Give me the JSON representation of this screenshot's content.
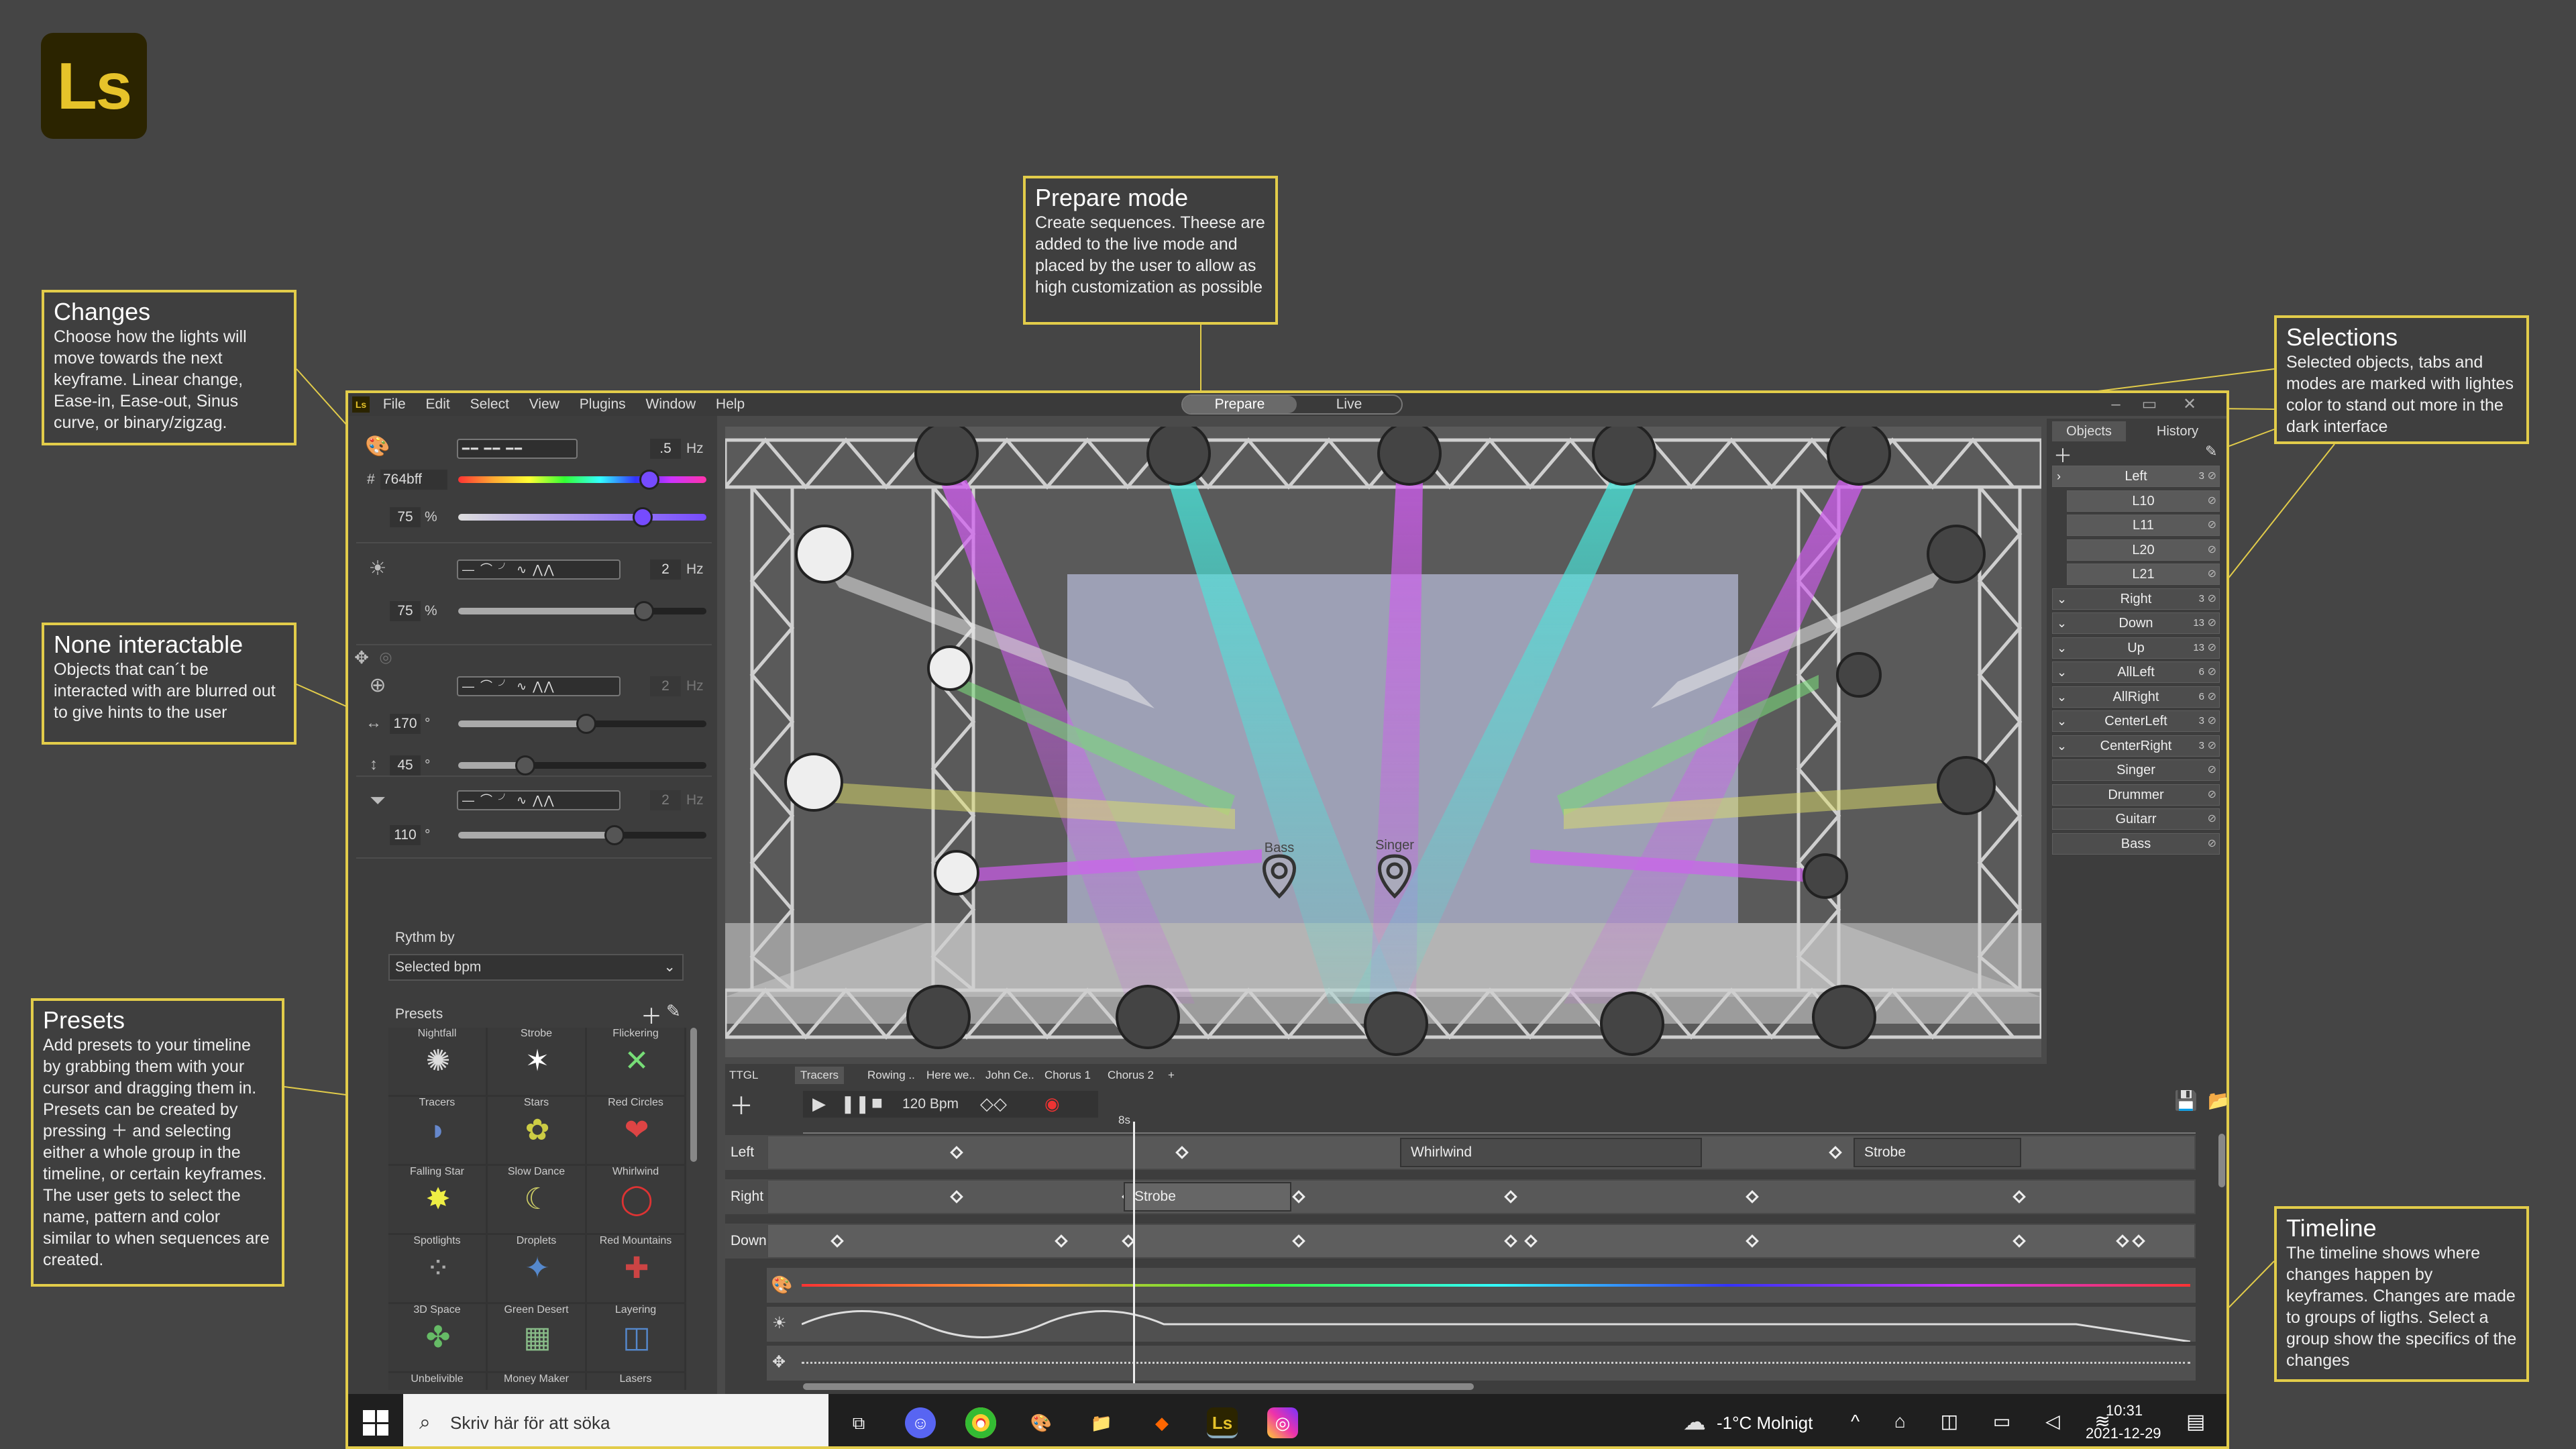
{
  "logo": "Ls",
  "notes": {
    "prepare": {
      "title": "Prepare mode",
      "body": "Create sequences. Theese are added to the live mode and placed by the user to allow as high customization as possible"
    },
    "changes": {
      "title": "Changes",
      "body": "Choose how the lights will move towards the next keyframe. Linear change, Ease-in, Ease-out, Sinus curve, or binary/zigzag."
    },
    "none": {
      "title": "None interactable",
      "body": "Objects that can´t be interacted with are blurred out to give hints to the user"
    },
    "presets": {
      "title": "Presets",
      "body": "Add presets to your timeline by grabbing them with your cursor and dragging them in. Presets can be created by pressing ＋ and selecting either a whole group in the timeline, or certain keyframes. The user gets to select the name, pattern and color similar to when sequences are created."
    },
    "selections": {
      "title": "Selections",
      "body": "Selected objects, tabs and modes are marked with lightes color to stand out more in the dark interface"
    },
    "timeline": {
      "title": "Timeline",
      "body": "The timeline shows where changes happen by keyframes. Changes are made to groups of ligths. Select a group show the specifics of the changes"
    }
  },
  "app": {
    "menu": [
      "File",
      "Edit",
      "Select",
      "View",
      "Plugins",
      "Window",
      "Help"
    ],
    "modes": {
      "prepare": "Prepare",
      "live": "Live"
    },
    "window_buttons": [
      "–",
      "▭",
      "✕"
    ]
  },
  "left": {
    "color": {
      "hz": ".5",
      "hz_unit": "Hz",
      "hex": "764bff",
      "hash": "#",
      "saturation": "75",
      "pct": "%"
    },
    "brightness": {
      "hz": "2",
      "hz_unit": "Hz",
      "value": "75",
      "pct": "%"
    },
    "movement": {
      "hz": "2",
      "hz_unit": "Hz",
      "pan": "170",
      "tilt": "45",
      "deg": "°"
    },
    "zoom": {
      "hz": "2",
      "hz_unit": "Hz",
      "value": "110",
      "deg": "°"
    },
    "wave_shapes": "— ⌒ ╯ ∿ ⋀⋀",
    "rhythm_label": "Rythm by",
    "rhythm_value": "Selected bpm",
    "presets_label": "Presets",
    "presets": [
      "Nightfall",
      "Strobe",
      "Flickering",
      "Tracers",
      "Stars",
      "Red Circles",
      "Falling Star",
      "Slow Dance",
      "Whirlwind",
      "Spotlights",
      "Droplets",
      "Red Mountains",
      "3D Space",
      "Green Desert",
      "Layering",
      "Unbelivible",
      "Money Maker",
      "Lasers"
    ]
  },
  "stage": {
    "markers": [
      "Bass",
      "Singer"
    ]
  },
  "right": {
    "tabs": {
      "objects": "Objects",
      "history": "History"
    },
    "rows": [
      {
        "name": "Left",
        "count": "3",
        "indent": false,
        "caret": "›"
      },
      {
        "name": "L10",
        "count": "",
        "indent": true,
        "caret": ""
      },
      {
        "name": "L11",
        "count": "",
        "indent": true,
        "caret": ""
      },
      {
        "name": "L20",
        "count": "",
        "indent": true,
        "caret": ""
      },
      {
        "name": "L21",
        "count": "",
        "indent": true,
        "caret": ""
      },
      {
        "name": "Right",
        "count": "3",
        "indent": false,
        "caret": "⌄"
      },
      {
        "name": "Down",
        "count": "13",
        "indent": false,
        "caret": "⌄"
      },
      {
        "name": "Up",
        "count": "13",
        "indent": false,
        "caret": "⌄"
      },
      {
        "name": "AllLeft",
        "count": "6",
        "indent": false,
        "caret": "⌄"
      },
      {
        "name": "AllRight",
        "count": "6",
        "indent": false,
        "caret": "⌄"
      },
      {
        "name": "CenterLeft",
        "count": "3",
        "indent": false,
        "caret": "⌄"
      },
      {
        "name": "CenterRight",
        "count": "3",
        "indent": false,
        "caret": "⌄"
      },
      {
        "name": "Singer",
        "count": "",
        "indent": false,
        "caret": ""
      },
      {
        "name": "Drummer",
        "count": "",
        "indent": false,
        "caret": ""
      },
      {
        "name": "Guitarr",
        "count": "",
        "indent": false,
        "caret": ""
      },
      {
        "name": "Bass",
        "count": "",
        "indent": false,
        "caret": ""
      }
    ]
  },
  "timeline": {
    "tabs": [
      "TTGL",
      "Tracers",
      "Rowing ..",
      "Here we..",
      "John Ce..",
      "Chorus 1",
      "Chorus 2",
      "+"
    ],
    "bpm": "120 Bpm",
    "playhead": "8s",
    "lanes": [
      "Left",
      "Right",
      "Down"
    ],
    "clips": [
      "Whirlwind",
      "Strobe",
      "Strobe"
    ]
  },
  "taskbar": {
    "search": "Skriv här för att söka",
    "weather": "-1°C  Molnigt",
    "time": "10:31",
    "date": "2021-12-29",
    "app": "Ls"
  },
  "colors": {
    "accent": "#e2cc4a",
    "magenta": "#d05cf0",
    "cyan": "#49e7dc",
    "yellow": "#dcdc6a",
    "green": "#7ad87a"
  }
}
